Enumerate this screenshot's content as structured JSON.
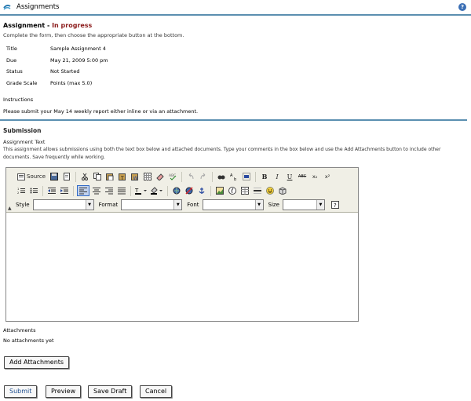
{
  "window": {
    "title": "Assignments"
  },
  "assignment": {
    "heading_label": "Assignment - ",
    "status": "In progress",
    "intro": "Complete the form, then choose the appropriate button at the bottom.",
    "fields": [
      {
        "key": "Title",
        "value": "Sample Assignment 4"
      },
      {
        "key": "Due",
        "value": "May 21, 2009 5:00 pm"
      },
      {
        "key": "Status",
        "value": "Not Started"
      },
      {
        "key": "Grade Scale",
        "value": "Points (max 5.0)"
      }
    ],
    "instructions_label": "Instructions",
    "instructions": "Please submit your May 14 weekly report either inline or via an attachment."
  },
  "submission": {
    "heading": "Submission",
    "assignment_text_label": "Assignment Text",
    "description": "This assignment allows submissions using both the text box below and attached documents. Type your comments in the box below and use the Add Attachments button to include other documents. Save frequently while working."
  },
  "editor": {
    "source_label": "Source",
    "style_label": "Style",
    "format_label": "Format",
    "font_label": "Font",
    "size_label": "Size",
    "bold": "B",
    "italic": "I",
    "underline": "U",
    "strike": "ABC",
    "sub": "x₂",
    "sup": "x²"
  },
  "attachments": {
    "label": "Attachments",
    "none": "No attachments yet",
    "add_button": "Add Attachments"
  },
  "actions": {
    "submit": "Submit",
    "preview": "Preview",
    "save_draft": "Save Draft",
    "cancel": "Cancel"
  },
  "colors": {
    "accent": "#5b8fb0",
    "status": "#8b1a1a",
    "primary_button_text": "#1e4f8f"
  }
}
